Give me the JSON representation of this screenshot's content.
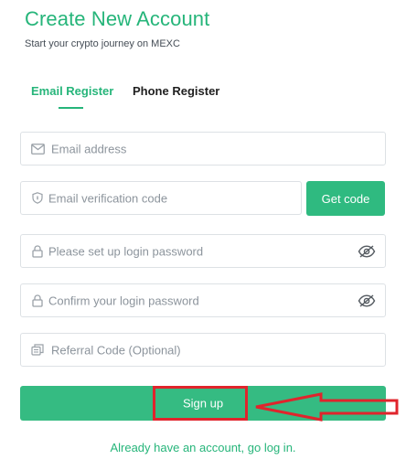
{
  "header": {
    "title": "Create New Account",
    "subtitle": "Start your crypto journey on MEXC"
  },
  "tabs": [
    {
      "label": "Email Register",
      "active": true
    },
    {
      "label": "Phone Register",
      "active": false
    }
  ],
  "form": {
    "email": {
      "placeholder": "Email address",
      "value": "",
      "icon": "mail-icon"
    },
    "verification": {
      "placeholder": "Email verification code",
      "value": "",
      "icon": "shield-icon",
      "button_label": "Get code"
    },
    "password": {
      "placeholder": "Please set up login password",
      "value": "",
      "icon": "lock-icon",
      "toggle_icon": "eye-off-icon"
    },
    "confirm_password": {
      "placeholder": "Confirm your login password",
      "value": "",
      "icon": "lock-icon",
      "toggle_icon": "eye-off-icon"
    },
    "referral": {
      "placeholder": "Referral Code (Optional)",
      "value": "",
      "icon": "copy-icon"
    }
  },
  "actions": {
    "signup_label": "Sign up",
    "login_link": "Already have an account, go log in."
  },
  "annotations": {
    "highlight_color": "#e0242c",
    "arrow_color": "#e0242c"
  },
  "colors": {
    "brand": "#26b57a",
    "button": "#35bb82",
    "border": "#dde1e5",
    "placeholder": "#8c949c"
  }
}
